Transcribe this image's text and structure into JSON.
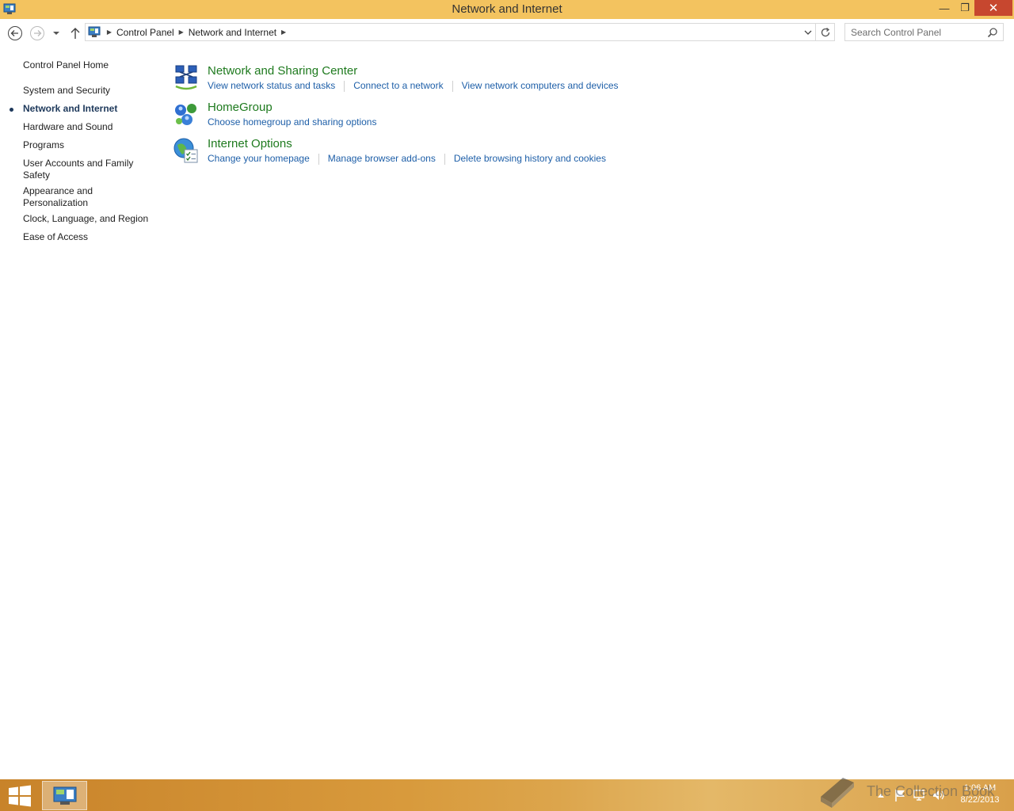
{
  "window": {
    "title": "Network and Internet",
    "minimize_label": "—",
    "maximize_label": "❐",
    "close_label": "✕"
  },
  "address": {
    "breadcrumbs": [
      "Control Panel",
      "Network and Internet"
    ],
    "search_placeholder": "Search Control Panel"
  },
  "sidebar": {
    "home": "Control Panel Home",
    "items": [
      {
        "label": "System and Security",
        "active": false
      },
      {
        "label": "Network and Internet",
        "active": true
      },
      {
        "label": "Hardware and Sound",
        "active": false
      },
      {
        "label": "Programs",
        "active": false
      },
      {
        "label": "User Accounts and Family Safety",
        "active": false
      },
      {
        "label": "Appearance and Personalization",
        "active": false
      },
      {
        "label": "Clock, Language, and Region",
        "active": false
      },
      {
        "label": "Ease of Access",
        "active": false
      }
    ]
  },
  "categories": [
    {
      "title": "Network and Sharing Center",
      "icon": "network-sharing-icon",
      "links": [
        "View network status and tasks",
        "Connect to a network",
        "View network computers and devices"
      ]
    },
    {
      "title": "HomeGroup",
      "icon": "homegroup-icon",
      "links": [
        "Choose homegroup and sharing options"
      ]
    },
    {
      "title": "Internet Options",
      "icon": "internet-options-icon",
      "links": [
        "Change your homepage",
        "Manage browser add-ons",
        "Delete browsing history and cookies"
      ]
    }
  ],
  "taskbar": {
    "clock_time": "1:06 AM",
    "clock_date": "8/22/2013",
    "watermark": "The Collection Book"
  },
  "colors": {
    "titlebar": "#f3c35f",
    "category_title": "#1e7a1e",
    "link": "#1e5fa8",
    "close_button": "#c7472f"
  }
}
